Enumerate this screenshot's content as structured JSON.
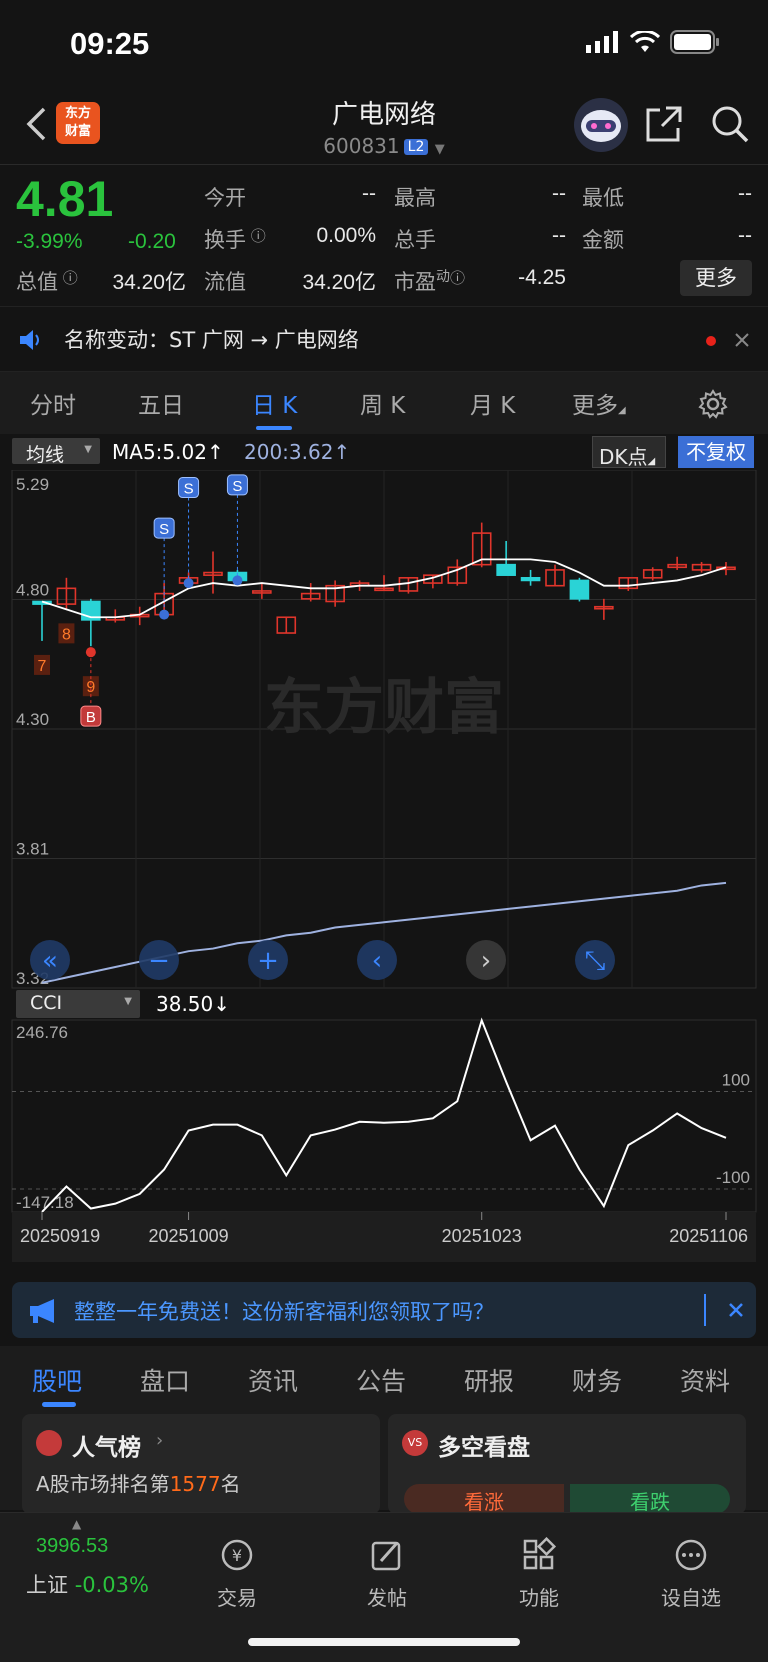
{
  "status": {
    "time": "09:25"
  },
  "header": {
    "logo_text_1": "东方",
    "logo_text_2": "财富",
    "stock_name": "广电网络",
    "stock_code": "600831",
    "level_badge": "L2"
  },
  "quote": {
    "price": "4.81",
    "change_pct": "-3.99%",
    "change_amt": "-0.20",
    "fields": [
      {
        "label": "今开",
        "value": "--"
      },
      {
        "label": "最高",
        "value": "--"
      },
      {
        "label": "最低",
        "value": "--"
      },
      {
        "label": "换手",
        "value": "0.00%"
      },
      {
        "label": "总手",
        "value": "--"
      },
      {
        "label": "金额",
        "value": "--"
      },
      {
        "label": "总值",
        "value": "34.20亿"
      },
      {
        "label": "流值",
        "value": "34.20亿"
      },
      {
        "label": "市盈",
        "label_sup": "动",
        "value": "-4.25"
      }
    ],
    "more_label": "更多"
  },
  "notice": {
    "text": "名称变动：ST 广网 → 广电网络"
  },
  "tabs": [
    "分时",
    "五日",
    "日 K",
    "周 K",
    "月 K",
    "更多"
  ],
  "chart_header": {
    "ma_select": "均线",
    "ma5": "MA5:5.02",
    "ma200": "200:3.62",
    "dk_button": "DK点",
    "adjust_button": "不复权"
  },
  "colors": {
    "up": "#e0352b",
    "down": "#2ad3d6",
    "ma5": "#ffffff",
    "ma200": "#9fb2e0",
    "accent": "#3b86ff",
    "green": "#2ac33d"
  },
  "chart_data": {
    "type": "candlestick",
    "y_axis_labels": [
      "5.29",
      "4.80",
      "4.30",
      "3.81",
      "3.32"
    ],
    "ylim": [
      3.32,
      5.29
    ],
    "candles": [
      {
        "o": 4.79,
        "c": 4.78,
        "h": 4.79,
        "l": 4.64
      },
      {
        "o": 4.78,
        "c": 4.84,
        "h": 4.88,
        "l": 4.76
      },
      {
        "o": 4.79,
        "c": 4.72,
        "h": 4.8,
        "l": 4.62
      },
      {
        "o": 4.72,
        "c": 4.73,
        "h": 4.76,
        "l": 4.71
      },
      {
        "o": 4.74,
        "c": 4.74,
        "h": 4.77,
        "l": 4.7
      },
      {
        "o": 4.74,
        "c": 4.82,
        "h": 4.86,
        "l": 4.74
      },
      {
        "o": 4.86,
        "c": 4.88,
        "h": 4.9,
        "l": 4.84
      },
      {
        "o": 4.89,
        "c": 4.9,
        "h": 4.98,
        "l": 4.82
      },
      {
        "o": 4.9,
        "c": 4.87,
        "h": 4.91,
        "l": 4.85
      },
      {
        "o": 4.83,
        "c": 4.83,
        "h": 4.86,
        "l": 4.8
      },
      {
        "o": 4.67,
        "c": 4.73,
        "h": 4.73,
        "l": 4.67
      },
      {
        "o": 4.8,
        "c": 4.82,
        "h": 4.86,
        "l": 4.79
      },
      {
        "o": 4.79,
        "c": 4.85,
        "h": 4.87,
        "l": 4.77
      },
      {
        "o": 4.85,
        "c": 4.86,
        "h": 4.87,
        "l": 4.83
      },
      {
        "o": 4.84,
        "c": 4.84,
        "h": 4.89,
        "l": 4.83
      },
      {
        "o": 4.83,
        "c": 4.88,
        "h": 4.88,
        "l": 4.82
      },
      {
        "o": 4.86,
        "c": 4.89,
        "h": 4.89,
        "l": 4.84
      },
      {
        "o": 4.86,
        "c": 4.92,
        "h": 4.95,
        "l": 4.85
      },
      {
        "o": 4.93,
        "c": 5.05,
        "h": 5.09,
        "l": 4.92
      },
      {
        "o": 4.93,
        "c": 4.89,
        "h": 5.02,
        "l": 4.89
      },
      {
        "o": 4.88,
        "c": 4.87,
        "h": 4.91,
        "l": 4.85
      },
      {
        "o": 4.85,
        "c": 4.91,
        "h": 4.93,
        "l": 4.85
      },
      {
        "o": 4.87,
        "c": 4.8,
        "h": 4.88,
        "l": 4.79
      },
      {
        "o": 4.77,
        "c": 4.77,
        "h": 4.8,
        "l": 4.72
      },
      {
        "o": 4.84,
        "c": 4.88,
        "h": 4.88,
        "l": 4.83
      },
      {
        "o": 4.88,
        "c": 4.91,
        "h": 4.92,
        "l": 4.87
      },
      {
        "o": 4.92,
        "c": 4.93,
        "h": 4.96,
        "l": 4.91
      },
      {
        "o": 4.91,
        "c": 4.93,
        "h": 4.94,
        "l": 4.9
      },
      {
        "o": 4.92,
        "c": 4.92,
        "h": 4.94,
        "l": 4.89
      }
    ],
    "ma5": [
      4.79,
      4.76,
      4.73,
      4.73,
      4.74,
      4.79,
      4.84,
      4.86,
      4.85,
      4.86,
      4.85,
      4.84,
      4.84,
      4.85,
      4.85,
      4.86,
      4.88,
      4.91,
      4.95,
      4.95,
      4.95,
      4.94,
      4.9,
      4.85,
      4.85,
      4.86,
      4.87,
      4.89,
      4.92
    ],
    "ma200": [
      3.34,
      3.36,
      3.38,
      3.4,
      3.42,
      3.44,
      3.46,
      3.47,
      3.49,
      3.5,
      3.52,
      3.53,
      3.55,
      3.56,
      3.57,
      3.58,
      3.59,
      3.6,
      3.61,
      3.62,
      3.63,
      3.64,
      3.65,
      3.66,
      3.67,
      3.68,
      3.69,
      3.71,
      3.72
    ],
    "signals": [
      {
        "index": 0,
        "label": "7",
        "kind": "count"
      },
      {
        "index": 1,
        "label": "8",
        "kind": "count"
      },
      {
        "index": 2,
        "label": "9",
        "kind": "count"
      },
      {
        "index": 2,
        "label": "B",
        "kind": "buy"
      },
      {
        "index": 5,
        "label": "S",
        "kind": "sell"
      },
      {
        "index": 6,
        "label": "S",
        "kind": "sell"
      },
      {
        "index": 8,
        "label": "S",
        "kind": "sell"
      }
    ],
    "watermark": "东方财富",
    "cci": {
      "name": "CCI",
      "value": "38.50",
      "y_axis_labels": [
        "246.76",
        "-147.18"
      ],
      "ref_labels": [
        "100",
        "-100"
      ],
      "ylim": [
        -147.18,
        246.76
      ],
      "values": [
        -147,
        -95,
        -140,
        -130,
        -110,
        -60,
        20,
        32,
        32,
        10,
        -72,
        10,
        22,
        38,
        36,
        38,
        45,
        80,
        246,
        120,
        0,
        30,
        -60,
        -135,
        -10,
        20,
        55,
        25,
        5
      ]
    },
    "x_labels": [
      {
        "index": 0,
        "label": "20250919"
      },
      {
        "index": 6,
        "label": "20251009"
      },
      {
        "index": 18,
        "label": "20251023"
      },
      {
        "index": 28,
        "label": "20251106"
      }
    ]
  },
  "ad": {
    "text": "整整一年免费送！这份新客福利您领取了吗？"
  },
  "bottom_tabs": [
    "股吧",
    "盘口",
    "资讯",
    "公告",
    "研报",
    "财务",
    "资料"
  ],
  "cards": {
    "popular_title": "人气榜",
    "rank_prefix": "A股市场排名第",
    "rank": "1577",
    "rank_suffix": "名",
    "vote_title": "多空看盘",
    "bull": "看涨",
    "bear": "看跌"
  },
  "bottom_nav": {
    "index_value": "3996.53",
    "index_name": "上证",
    "index_change": "-0.03%",
    "items": [
      "交易",
      "发帖",
      "功能",
      "设自选"
    ]
  }
}
